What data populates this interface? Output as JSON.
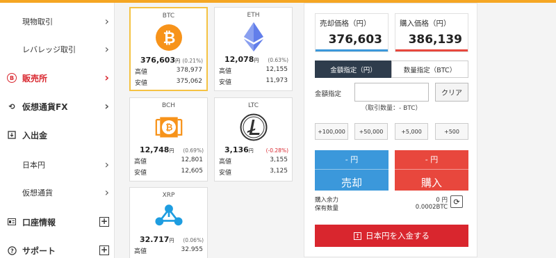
{
  "sidebar": {
    "items": [
      {
        "label": "現物取引",
        "kind": "sub",
        "control": "chevron"
      },
      {
        "label": "レバレッジ取引",
        "kind": "sub",
        "control": "chevron"
      },
      {
        "label": "販売所",
        "kind": "main",
        "control": "chevron",
        "active": true,
        "icon": "bitcoin-circle-icon"
      },
      {
        "label": "仮想通貨FX",
        "kind": "main",
        "control": "chevron",
        "icon": "sync-icon"
      },
      {
        "label": "入出金",
        "kind": "main",
        "control": "none",
        "icon": "deposit-box-icon"
      },
      {
        "label": "日本円",
        "kind": "sub",
        "control": "chevron"
      },
      {
        "label": "仮想通貨",
        "kind": "sub",
        "control": "chevron"
      },
      {
        "label": "口座情報",
        "kind": "main",
        "control": "plus",
        "icon": "account-card-icon"
      },
      {
        "label": "サポート",
        "kind": "main",
        "control": "plus",
        "icon": "help-circle-icon"
      }
    ]
  },
  "coins": [
    {
      "symbol": "BTC",
      "price": "376,603",
      "yen": "円",
      "change": "(0.21%)",
      "negative": false,
      "high_label": "高値",
      "high": "378,977",
      "low_label": "安値",
      "low": "375,062",
      "selected": true,
      "icon": "bitcoin-icon",
      "color": "#f7931a"
    },
    {
      "symbol": "ETH",
      "price": "12,078",
      "yen": "円",
      "change": "(0.63%)",
      "negative": false,
      "high_label": "高値",
      "high": "12,155",
      "low_label": "安値",
      "low": "11,973",
      "selected": false,
      "icon": "ethereum-icon",
      "color": "#627eea"
    },
    {
      "symbol": "BCH",
      "price": "12,748",
      "yen": "円",
      "change": "(0.69%)",
      "negative": false,
      "high_label": "高値",
      "high": "12,801",
      "low_label": "安値",
      "low": "12,605",
      "selected": false,
      "icon": "bitcoin-cash-icon",
      "color": "#f7931a"
    },
    {
      "symbol": "LTC",
      "price": "3,136",
      "yen": "円",
      "change": "(-0.28%)",
      "negative": true,
      "high_label": "高値",
      "high": "3,155",
      "low_label": "安値",
      "low": "3,125",
      "selected": false,
      "icon": "litecoin-icon",
      "color": "#333333"
    },
    {
      "symbol": "XRP",
      "price": "32.717",
      "yen": "円",
      "change": "(0.06%)",
      "negative": false,
      "high_label": "高値",
      "high": "32.955",
      "selected": false,
      "icon": "ripple-icon",
      "color": "#1e9de0"
    }
  ],
  "trade": {
    "sell_price_label": "売却価格（円）",
    "sell_price": "376,603",
    "buy_price_label": "購入価格（円）",
    "buy_price": "386,139",
    "tab_amount": "金額指定（円）",
    "tab_quantity": "数量指定（BTC）",
    "amount_label": "金額指定",
    "amount_value": "",
    "clear_label": "クリア",
    "min_note": "（取引数量：‐ BTC）",
    "quick_amounts": [
      "+100,000",
      "+50,000",
      "+5,000",
      "+500"
    ],
    "sell_yen": "‐ 円",
    "sell_label": "売却",
    "buy_yen": "‐ 円",
    "buy_label": "購入",
    "balance_label": "購入余力",
    "balance_value": "0 円",
    "holding_label": "保有数量",
    "holding_value": "0.0002BTC",
    "deposit_label": "日本円を入金する"
  },
  "colors": {
    "accent_orange": "#f5a623",
    "sell_blue": "#3b98db",
    "buy_red": "#e8473d",
    "active_red": "#d9262e",
    "tab_dark": "#2e3c4c"
  }
}
